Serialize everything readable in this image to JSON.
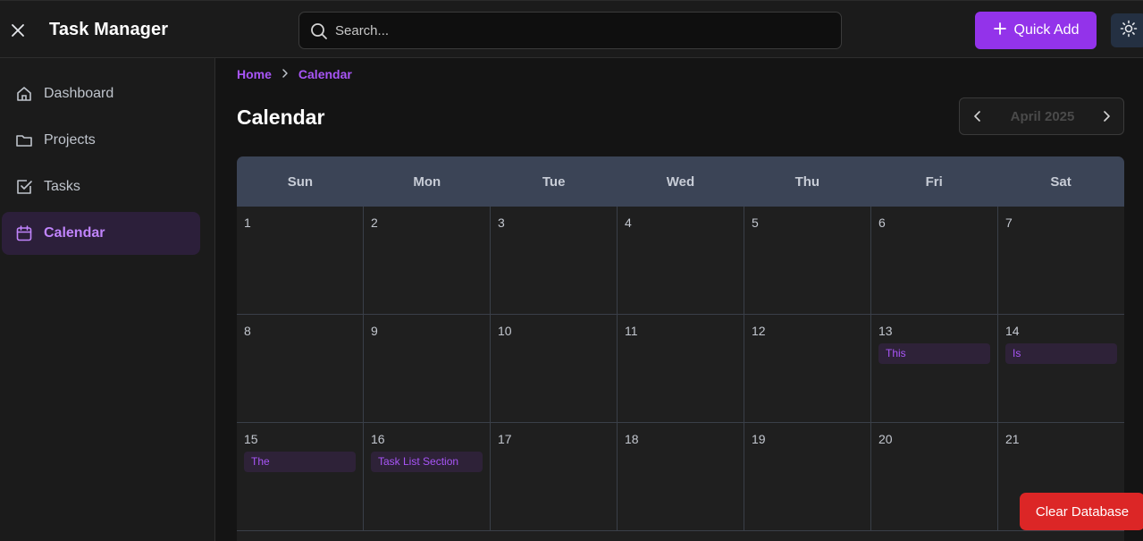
{
  "app": {
    "title": "Task Manager"
  },
  "header": {
    "search_placeholder": "Search...",
    "quick_add_label": "Quick Add"
  },
  "sidebar": {
    "items": [
      {
        "label": "Dashboard",
        "icon": "home-icon",
        "active": false
      },
      {
        "label": "Projects",
        "icon": "folder-icon",
        "active": false
      },
      {
        "label": "Tasks",
        "icon": "checkbox-icon",
        "active": false
      },
      {
        "label": "Calendar",
        "icon": "calendar-icon",
        "active": true
      }
    ]
  },
  "breadcrumb": [
    "Home",
    "Calendar"
  ],
  "page": {
    "title": "Calendar",
    "month_label": "April 2025"
  },
  "calendar": {
    "weekdays": [
      "Sun",
      "Mon",
      "Tue",
      "Wed",
      "Thu",
      "Fri",
      "Sat"
    ],
    "days": [
      {
        "n": "1"
      },
      {
        "n": "2"
      },
      {
        "n": "3"
      },
      {
        "n": "4"
      },
      {
        "n": "5"
      },
      {
        "n": "6"
      },
      {
        "n": "7"
      },
      {
        "n": "8"
      },
      {
        "n": "9"
      },
      {
        "n": "10"
      },
      {
        "n": "11"
      },
      {
        "n": "12"
      },
      {
        "n": "13",
        "task": "This"
      },
      {
        "n": "14",
        "task": "Is"
      },
      {
        "n": "15",
        "task": "The"
      },
      {
        "n": "16",
        "task": "Task List Section"
      },
      {
        "n": "17"
      },
      {
        "n": "18"
      },
      {
        "n": "19"
      },
      {
        "n": "20"
      },
      {
        "n": "21"
      }
    ]
  },
  "footer": {
    "clear_db_label": "Clear Database"
  },
  "colors": {
    "accent": "#9333ea",
    "danger": "#dc2626",
    "header_row": "#3b4456"
  }
}
